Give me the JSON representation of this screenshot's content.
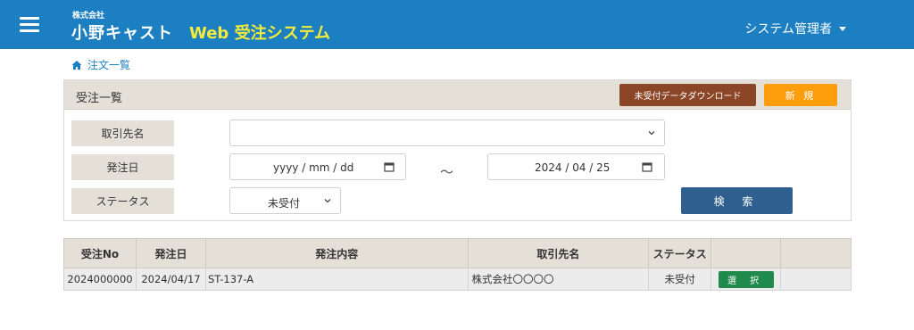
{
  "header": {
    "company_small": "株式会社",
    "company_name": "小野キャスト",
    "system_name": "Web 受注システム",
    "user_menu": "システム管理者"
  },
  "breadcrumb": {
    "label": "注文一覧"
  },
  "panel": {
    "title": "受注一覧",
    "download_button": "未受付データダウンロード",
    "new_button": "新 規"
  },
  "filters": {
    "client_label": "取引先名",
    "client_value": "",
    "order_date_label": "発注日",
    "date_from": "yyyy / mm / dd",
    "date_separator": "〜",
    "date_to": "2024 / 04 / 25",
    "status_label": "ステータス",
    "status_value": "未受付",
    "search_button": "検 索"
  },
  "table": {
    "headers": [
      "受注No",
      "発注日",
      "発注内容",
      "取引先名",
      "ステータス",
      "",
      ""
    ],
    "rows": [
      {
        "order_no": "2024000000",
        "order_date": "2024/04/17",
        "content": "ST-137-A",
        "client": "株式会社〇〇〇〇",
        "status": "未受付",
        "action": "選 択"
      }
    ]
  },
  "colors": {
    "header_bg": "#1b7fc1",
    "system_name": "#f5ec3b",
    "download_button": "#8b4527",
    "new_button": "#ff9e0d",
    "search_button": "#2e5f8f",
    "select_button": "#1f8a4c"
  }
}
